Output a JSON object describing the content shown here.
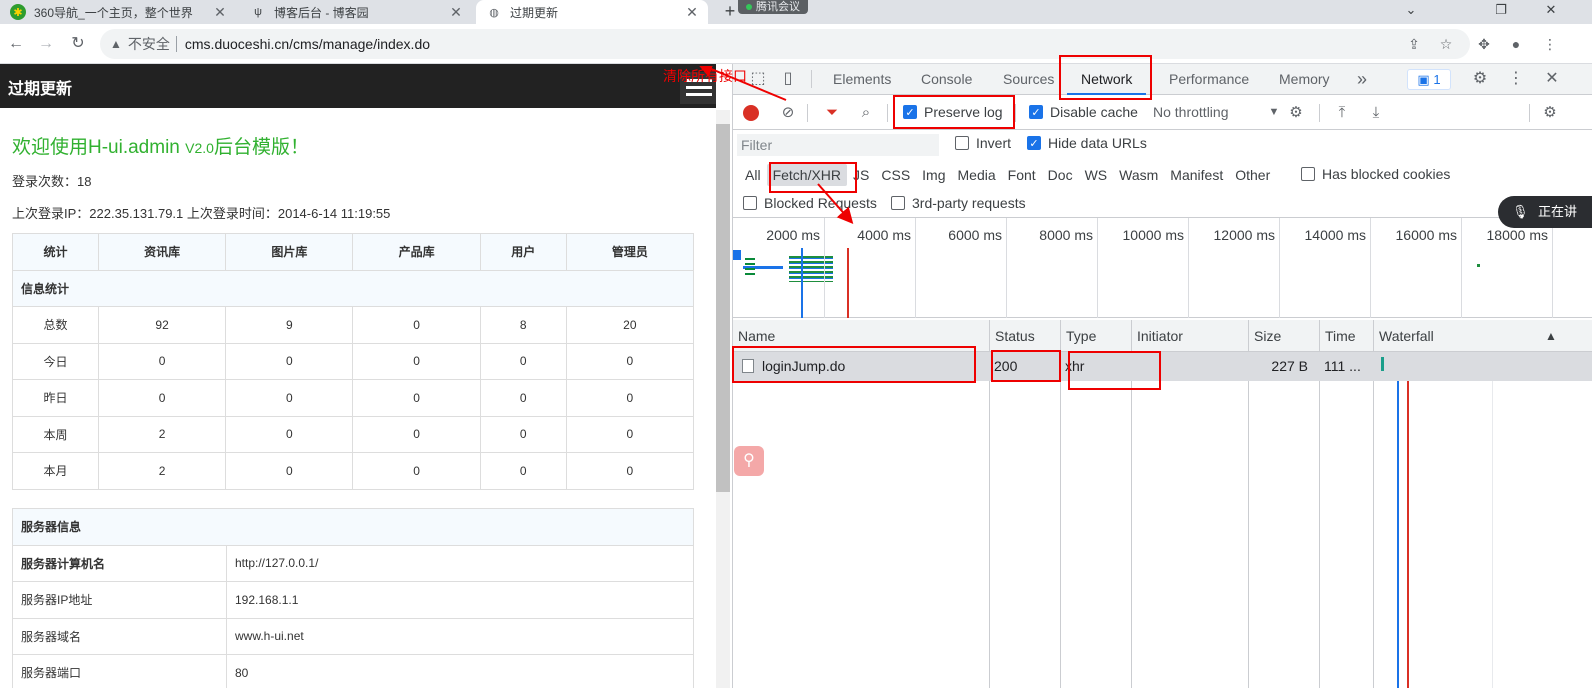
{
  "browser": {
    "tabs": [
      {
        "title": "360导航_一个主页，整个世界",
        "icon": "360-icon"
      },
      {
        "title": "博客后台 - 博客园",
        "icon": "cnblogs-icon"
      },
      {
        "title": "过期更新",
        "icon": "globe-icon"
      }
    ],
    "meeting_label": "腾讯会议",
    "security_label": "不安全",
    "url": "cms.duoceshi.cn/cms/manage/index.do"
  },
  "page": {
    "header_title": "过期更新",
    "welcome_main": "欢迎使用H-ui.admin ",
    "welcome_ver": "V2.0",
    "welcome_tail": "后台模版！",
    "login_count": "登录次数：18",
    "last_login": "上次登录IP：222.35.131.79.1 上次登录时间：2014-6-14 11:19:55",
    "stats": {
      "caption": "信息统计",
      "headers": [
        "统计",
        "资讯库",
        "图片库",
        "产品库",
        "用户",
        "管理员"
      ],
      "rows": [
        [
          "总数",
          "92",
          "9",
          "0",
          "8",
          "20"
        ],
        [
          "今日",
          "0",
          "0",
          "0",
          "0",
          "0"
        ],
        [
          "昨日",
          "0",
          "0",
          "0",
          "0",
          "0"
        ],
        [
          "本周",
          "2",
          "0",
          "0",
          "0",
          "0"
        ],
        [
          "本月",
          "2",
          "0",
          "0",
          "0",
          "0"
        ]
      ]
    },
    "server": {
      "caption": "服务器信息",
      "rows": [
        [
          "服务器计算机名",
          "http://127.0.0.1/"
        ],
        [
          "服务器IP地址",
          "192.168.1.1"
        ],
        [
          "服务器域名",
          "www.h-ui.net"
        ],
        [
          "服务器端口",
          "80"
        ]
      ]
    }
  },
  "devtools": {
    "tabs": [
      "Elements",
      "Console",
      "Sources",
      "Network",
      "Performance",
      "Memory"
    ],
    "active_tab": "Network",
    "more": "»",
    "issues_count": "1",
    "toolbar": {
      "preserve_log": "Preserve log",
      "preserve_log_checked": true,
      "disable_cache": "Disable cache",
      "disable_cache_checked": true,
      "throttling": "No throttling"
    },
    "filter": {
      "placeholder": "Filter",
      "invert": "Invert",
      "hide_data_urls": "Hide data URLs",
      "types": [
        "All",
        "Fetch/XHR",
        "JS",
        "CSS",
        "Img",
        "Media",
        "Font",
        "Doc",
        "WS",
        "Wasm",
        "Manifest",
        "Other"
      ],
      "selected_type": "Fetch/XHR",
      "has_blocked_cookies": "Has blocked cookies",
      "blocked_requests": "Blocked Requests",
      "third_party": "3rd-party requests"
    },
    "timeline_labels": [
      "2000 ms",
      "4000 ms",
      "6000 ms",
      "8000 ms",
      "10000 ms",
      "12000 ms",
      "14000 ms",
      "16000 ms",
      "18000 ms"
    ],
    "columns": [
      "Name",
      "Status",
      "Type",
      "Initiator",
      "Size",
      "Time",
      "Waterfall"
    ],
    "requests": [
      {
        "name": "loginJump.do",
        "status": "200",
        "type": "xhr",
        "initiator": "",
        "size": "227 B",
        "time": "111 ..."
      }
    ]
  },
  "annotation": {
    "text": "清除所有接口"
  },
  "overlay": {
    "recording_label": "正在讲"
  }
}
